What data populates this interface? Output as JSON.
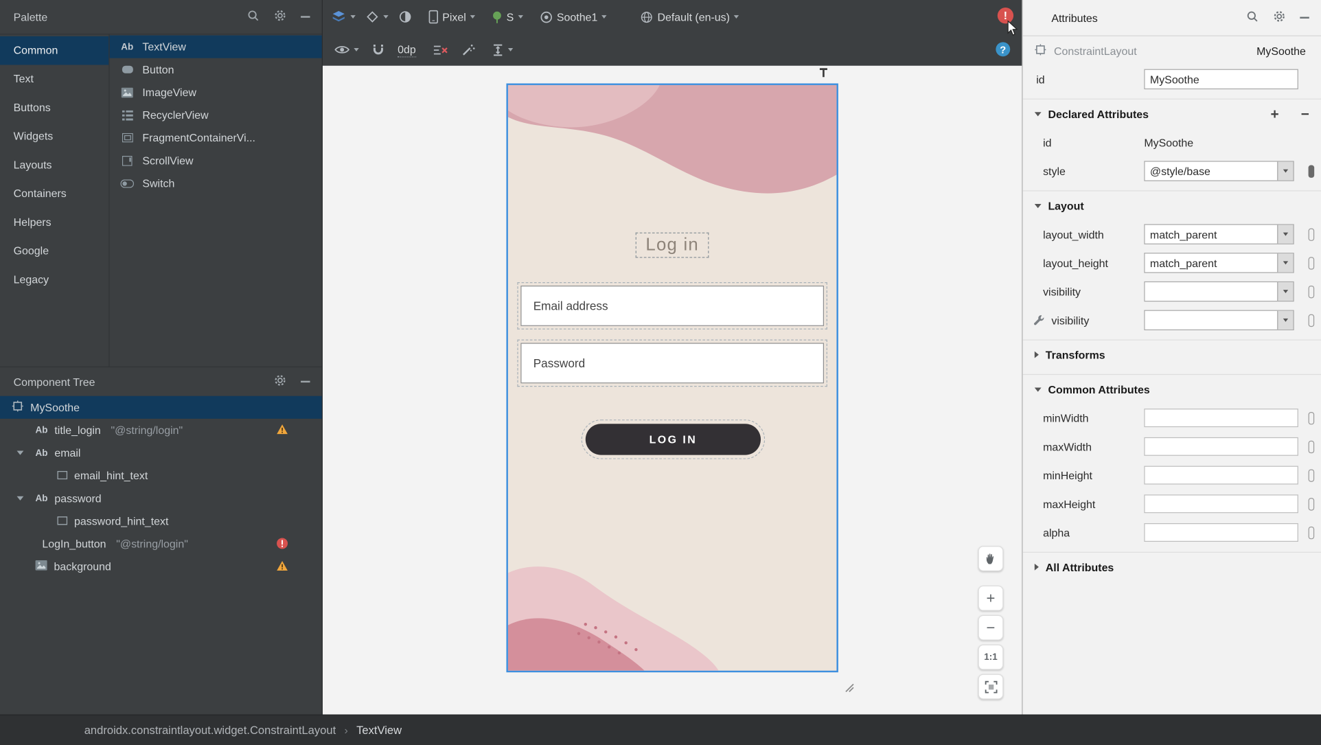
{
  "palette": {
    "title": "Palette",
    "categories": [
      "Common",
      "Text",
      "Buttons",
      "Widgets",
      "Layouts",
      "Containers",
      "Helpers",
      "Google",
      "Legacy"
    ],
    "components": [
      {
        "label": "TextView"
      },
      {
        "label": "Button"
      },
      {
        "label": "ImageView"
      },
      {
        "label": "RecyclerView"
      },
      {
        "label": "FragmentContainerVi..."
      },
      {
        "label": "ScrollView"
      },
      {
        "label": "Switch"
      }
    ]
  },
  "component_tree": {
    "title": "Component Tree",
    "items": [
      {
        "label": "MySoothe"
      },
      {
        "label": "title_login",
        "value": "\"@string/login\""
      },
      {
        "label": "email"
      },
      {
        "label": "email_hint_text"
      },
      {
        "label": "password"
      },
      {
        "label": "password_hint_text"
      },
      {
        "label": "LogIn_button",
        "value": "\"@string/login\""
      },
      {
        "label": "background"
      }
    ]
  },
  "design_toolbar": {
    "device": "Pixel",
    "api_level": "S",
    "theme": "Soothe1",
    "locale": "Default (en-us)",
    "default_margin": "0dp",
    "error_badge": "!"
  },
  "canvas": {
    "login_title": "Log in",
    "email_hint": "Email address",
    "password_hint": "Password",
    "login_button": "LOG IN",
    "zoom_in": "+",
    "zoom_out": "−",
    "zoom_100": "1:1"
  },
  "attributes_panel": {
    "title": "Attributes",
    "component_type": "ConstraintLayout",
    "component_id": "MySoothe",
    "id_row": {
      "label": "id",
      "value": "MySoothe"
    },
    "sections": {
      "declared": {
        "title": "Declared Attributes",
        "add": "+",
        "remove": "−",
        "rows": [
          {
            "name": "id",
            "value": "MySoothe"
          },
          {
            "name": "style",
            "value": "@style/base"
          }
        ]
      },
      "layout": {
        "title": "Layout",
        "rows": [
          {
            "name": "layout_width",
            "value": "match_parent"
          },
          {
            "name": "layout_height",
            "value": "match_parent"
          },
          {
            "name": "visibility",
            "value": ""
          },
          {
            "name": "visibility",
            "value": ""
          }
        ]
      },
      "transforms": {
        "title": "Transforms"
      },
      "common": {
        "title": "Common Attributes",
        "rows": [
          {
            "name": "minWidth"
          },
          {
            "name": "maxWidth"
          },
          {
            "name": "minHeight"
          },
          {
            "name": "maxHeight"
          },
          {
            "name": "alpha"
          }
        ]
      },
      "all": {
        "title": "All Attributes"
      }
    }
  },
  "breadcrumb": {
    "path": "androidx.constraintlayout.widget.ConstraintLayout",
    "separator": "›",
    "current": "TextView"
  },
  "colors": {
    "selection_blue": "#3d8fdf",
    "selected_row": "#113a5c",
    "panel_dark": "#3c3f41",
    "error_red": "#d8524f",
    "warning_yellow": "#f0a63c",
    "screen_beige": "#ede4db",
    "rose_dark": "#d7a6ad",
    "rose_light": "#e3bcc0",
    "button_dark": "#333034"
  }
}
